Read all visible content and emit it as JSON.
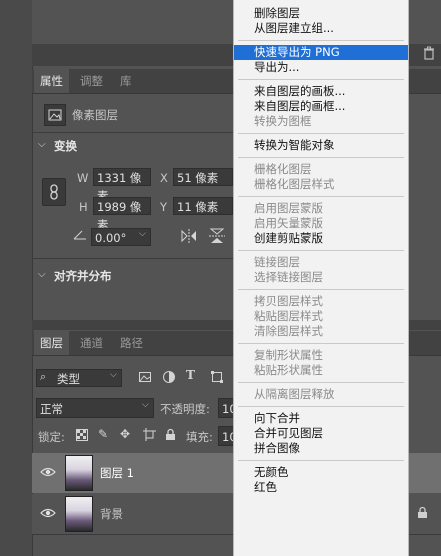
{
  "properties_panel": {
    "tabs": [
      "属性",
      "调整",
      "库"
    ],
    "layer_type": "像素图层",
    "transform_header": "变换",
    "w_label": "W",
    "w_value": "1331 像素",
    "x_label": "X",
    "x_value": "51 像素",
    "h_label": "H",
    "h_value": "1989 像素",
    "y_label": "Y",
    "y_value": "11 像素",
    "angle_value": "0.00°",
    "align_header": "对齐并分布"
  },
  "layers_panel": {
    "tabs": [
      "图层",
      "通道",
      "路径"
    ],
    "filter_kind": "类型",
    "blend_mode": "正常",
    "opacity_label": "不透明度:",
    "opacity_value": "10",
    "lock_label": "锁定:",
    "fill_label": "填充:",
    "fill_value": "10",
    "layers": [
      {
        "name": "图层 1",
        "selected": true
      },
      {
        "name": "背景",
        "selected": false
      }
    ]
  },
  "context_menu": {
    "items": [
      {
        "label": "删除图层",
        "disabled": false
      },
      {
        "label": "从图层建立组...",
        "disabled": false
      },
      {
        "sep": true
      },
      {
        "label": "快速导出为 PNG",
        "disabled": false,
        "highlighted": true
      },
      {
        "label": "导出为...",
        "disabled": false
      },
      {
        "sep": true
      },
      {
        "label": "来自图层的画板...",
        "disabled": false
      },
      {
        "label": "来自图层的画框...",
        "disabled": false
      },
      {
        "label": "转换为图框",
        "disabled": true
      },
      {
        "sep": true
      },
      {
        "label": "转换为智能对象",
        "disabled": false
      },
      {
        "sep": true
      },
      {
        "label": "栅格化图层",
        "disabled": true
      },
      {
        "label": "栅格化图层样式",
        "disabled": true
      },
      {
        "sep": true
      },
      {
        "label": "启用图层蒙版",
        "disabled": true
      },
      {
        "label": "启用矢量蒙版",
        "disabled": true
      },
      {
        "label": "创建剪贴蒙版",
        "disabled": false
      },
      {
        "sep": true
      },
      {
        "label": "链接图层",
        "disabled": true
      },
      {
        "label": "选择链接图层",
        "disabled": true
      },
      {
        "sep": true
      },
      {
        "label": "拷贝图层样式",
        "disabled": true
      },
      {
        "label": "粘贴图层样式",
        "disabled": true
      },
      {
        "label": "清除图层样式",
        "disabled": true
      },
      {
        "sep": true
      },
      {
        "label": "复制形状属性",
        "disabled": true
      },
      {
        "label": "粘贴形状属性",
        "disabled": true
      },
      {
        "sep": true
      },
      {
        "label": "从隔离图层释放",
        "disabled": true
      },
      {
        "sep": true
      },
      {
        "label": "向下合并",
        "disabled": false
      },
      {
        "label": "合并可见图层",
        "disabled": false
      },
      {
        "label": "拼合图像",
        "disabled": false
      },
      {
        "sep": true
      },
      {
        "label": "无颜色",
        "disabled": false
      },
      {
        "label": "红色",
        "disabled": false
      }
    ]
  }
}
